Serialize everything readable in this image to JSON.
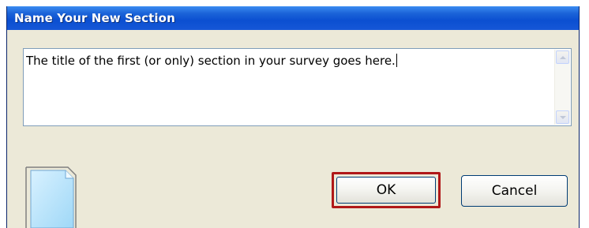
{
  "dialog": {
    "title": "Name Your New Section",
    "textbox": {
      "value": "The title of the first (or only) section in your survey goes here."
    },
    "buttons": {
      "ok_label": "OK",
      "cancel_label": "Cancel"
    },
    "icons": {
      "scroll_up": "chevron-up-icon",
      "scroll_down": "chevron-down-icon",
      "document": "document-icon"
    },
    "colors": {
      "titlebar": "#0b4fd1",
      "dialog_bg": "#ece9d8",
      "ok_highlight": "#b01818"
    }
  }
}
